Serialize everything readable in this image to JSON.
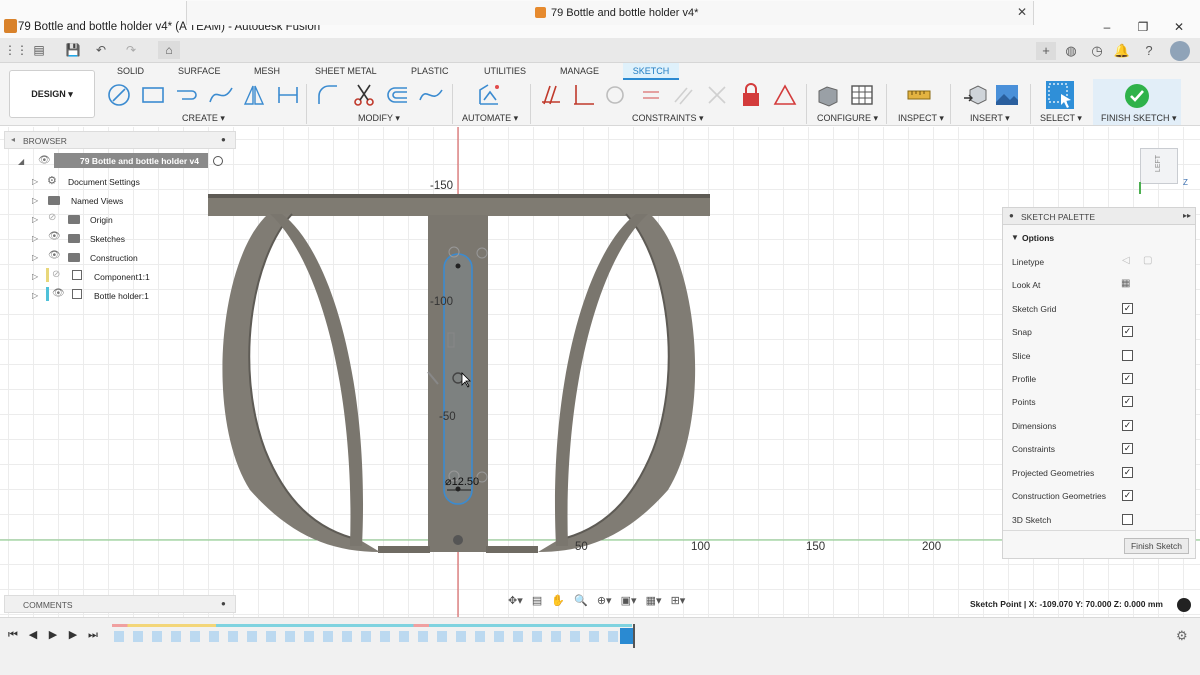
{
  "window": {
    "title": "79 Bottle and bottle holder v4* (A TEAM) - Autodesk Fusion",
    "controls": [
      "–",
      "❐",
      "✕"
    ]
  },
  "document_tab": {
    "title": "79 Bottle and bottle holder v4*",
    "close": "✕"
  },
  "design_button": "DESIGN ▾",
  "ribbon_tabs": [
    "SOLID",
    "SURFACE",
    "MESH",
    "SHEET METAL",
    "PLASTIC",
    "UTILITIES",
    "MANAGE",
    "SKETCH"
  ],
  "active_tab": "SKETCH",
  "ribbon_groups": {
    "create": "CREATE ▾",
    "modify": "MODIFY ▾",
    "automate": "AUTOMATE ▾",
    "constraints": "CONSTRAINTS ▾",
    "configure": "CONFIGURE ▾",
    "inspect": "INSPECT ▾",
    "insert": "INSERT ▾",
    "select": "SELECT ▾",
    "finish_sketch": "FINISH SKETCH ▾"
  },
  "browser": {
    "title": "BROWSER",
    "root": "79 Bottle and bottle holder v4",
    "items": [
      {
        "label": "Document Settings",
        "icon": "gear-icon"
      },
      {
        "label": "Named Views",
        "icon": "folder-icon"
      },
      {
        "label": "Origin",
        "icon": "folder-icon"
      },
      {
        "label": "Sketches",
        "icon": "folder-icon"
      },
      {
        "label": "Construction",
        "icon": "folder-icon"
      },
      {
        "label": "Component1:1",
        "icon": "component-icon"
      },
      {
        "label": "Bottle holder:1",
        "icon": "component-icon"
      }
    ]
  },
  "comments": {
    "title": "COMMENTS"
  },
  "sketch_palette": {
    "title": "SKETCH PALETTE",
    "section": "Options",
    "options": [
      {
        "label": "Linetype",
        "kind": "icons"
      },
      {
        "label": "Look At",
        "kind": "icon"
      },
      {
        "label": "Sketch Grid",
        "checked": true
      },
      {
        "label": "Snap",
        "checked": true
      },
      {
        "label": "Slice",
        "checked": false
      },
      {
        "label": "Profile",
        "checked": true
      },
      {
        "label": "Points",
        "checked": true
      },
      {
        "label": "Dimensions",
        "checked": true
      },
      {
        "label": "Constraints",
        "checked": true
      },
      {
        "label": "Projected Geometries",
        "checked": true
      },
      {
        "label": "Construction Geometries",
        "checked": true
      },
      {
        "label": "3D Sketch",
        "checked": false
      }
    ],
    "finish_button": "Finish Sketch"
  },
  "canvas": {
    "axis_labels_vertical": [
      "-150",
      "-100",
      "-50"
    ],
    "axis_labels_horizontal": [
      "50",
      "100",
      "150",
      "200"
    ],
    "dimension": "⌀12.50",
    "view_cube_face": "LEFT",
    "axis_z": "Z"
  },
  "status": {
    "readout": "Sketch Point | X: -109.070 Y: 70.000 Z: 0.000 mm"
  },
  "colors": {
    "accent": "#2a8ad2",
    "finish_green": "#2fb24a",
    "part_gray": "#7f7b72",
    "sketch_blue": "#3b8bd0"
  }
}
